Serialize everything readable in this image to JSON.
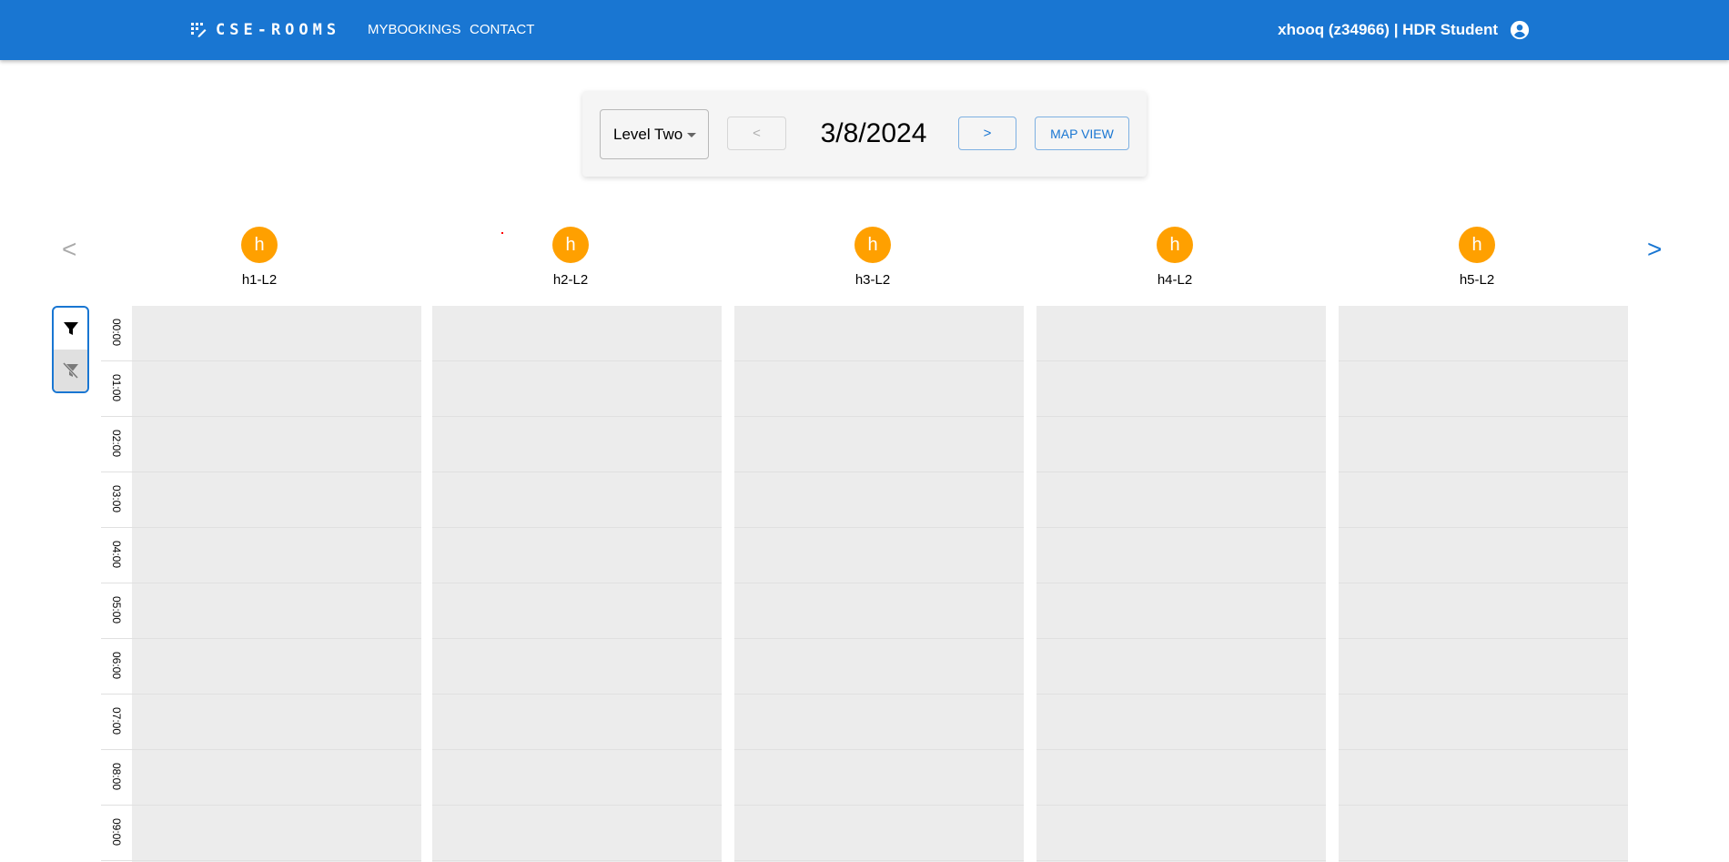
{
  "appbar": {
    "brand": "CSE-ROOMS",
    "brand_icon": "grid-calendar-icon",
    "nav": [
      "MYBOOKINGS",
      "CONTACT"
    ],
    "user": "xhooq (z34966) | HDR Student",
    "user_icon": "account-circle-icon",
    "color": "#1976d2"
  },
  "toolbar": {
    "level": "Level Two",
    "prev_label": "<",
    "next_label": ">",
    "date": "3/8/2024",
    "map_view_label": "MAP VIEW"
  },
  "rooms_nav": {
    "prev": "<",
    "next": ">"
  },
  "rooms": [
    {
      "avatar": "h",
      "name": "h1-L2"
    },
    {
      "avatar": "h",
      "name": "h2-L2"
    },
    {
      "avatar": "h",
      "name": "h3-L2"
    },
    {
      "avatar": "h",
      "name": "h4-L2"
    },
    {
      "avatar": "h",
      "name": "h5-L2"
    }
  ],
  "avatar_color": "#ffa000",
  "filters": {
    "apply_icon": "filter-icon",
    "clear_icon": "filter-off-icon"
  },
  "times": [
    "00:00",
    "01:00",
    "02:00",
    "03:00",
    "04:00",
    "05:00",
    "06:00",
    "07:00",
    "08:00",
    "09:00"
  ]
}
